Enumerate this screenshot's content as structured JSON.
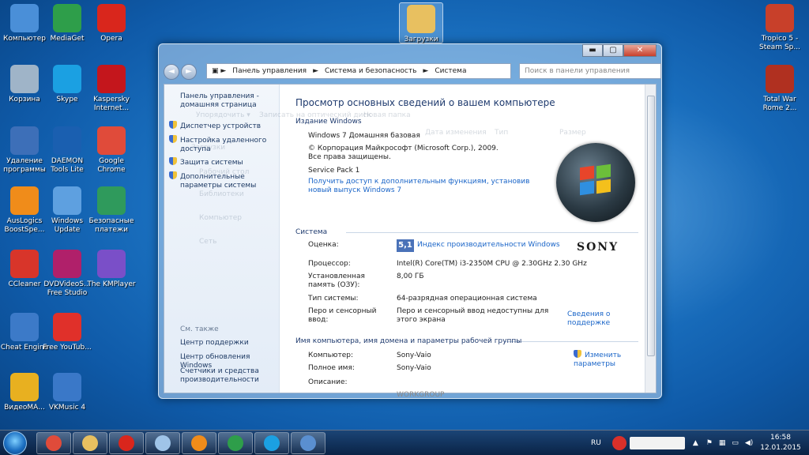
{
  "desktop": {
    "icons": [
      {
        "label": "Компьютер",
        "icon": "computer-icon",
        "color": "#4a8fd8"
      },
      {
        "label": "MediaGet",
        "icon": "mediaget-icon",
        "color": "#2e9e4a"
      },
      {
        "label": "Opera",
        "icon": "opera-icon",
        "color": "#d9261c"
      },
      {
        "label": "Корзина",
        "icon": "recycle-bin-icon",
        "color": "#9fb4c8"
      },
      {
        "label": "Skype",
        "icon": "skype-icon",
        "color": "#1ba0e2"
      },
      {
        "label": "Kaspersky Internet...",
        "icon": "kaspersky-icon",
        "color": "#c4161c"
      },
      {
        "label": "Удаление программы",
        "icon": "uninstall-icon",
        "color": "#3d6fb8"
      },
      {
        "label": "DAEMON Tools Lite",
        "icon": "daemon-tools-icon",
        "color": "#1a5fb0"
      },
      {
        "label": "Google Chrome",
        "icon": "chrome-icon",
        "color": "#e04b3a"
      },
      {
        "label": "AusLogics BoostSpe...",
        "icon": "auslogics-icon",
        "color": "#f08c1a"
      },
      {
        "label": "Windows Update",
        "icon": "windows-update-icon",
        "color": "#5ea0e0"
      },
      {
        "label": "Безопасные платежи",
        "icon": "safe-money-icon",
        "color": "#2f9a5c"
      },
      {
        "label": "CCleaner",
        "icon": "ccleaner-icon",
        "color": "#d8352a"
      },
      {
        "label": "DVDVideoS... Free Studio",
        "icon": "dvdvideosoft-icon",
        "color": "#b0206a"
      },
      {
        "label": "The KMPlayer",
        "icon": "kmplayer-icon",
        "color": "#7a4fc8"
      },
      {
        "label": "Cheat Engine",
        "icon": "cheat-engine-icon",
        "color": "#3c7ac8"
      },
      {
        "label": "Free YouTub...",
        "icon": "free-youtube-icon",
        "color": "#e0302a"
      },
      {
        "label": "ВидеоМА...",
        "icon": "videomaster-icon",
        "color": "#e8b020"
      },
      {
        "label": "VKMusic 4",
        "icon": "vkmusic-icon",
        "color": "#3a78c8"
      },
      {
        "label": "Загрузки",
        "icon": "downloads-folder-icon",
        "color": "#e8c060"
      },
      {
        "label": "Tropico 5 - Steam Sp...",
        "icon": "tropico-icon",
        "color": "#c8402a"
      },
      {
        "label": "Total War Rome 2...",
        "icon": "total-war-icon",
        "color": "#b03020"
      }
    ]
  },
  "window": {
    "controls": {
      "minimize": "▬",
      "maximize": "▢",
      "close": "✕"
    },
    "nav": {
      "back": "◄",
      "forward": "►"
    },
    "breadcrumb": [
      "Панель управления",
      "Система и безопасность",
      "Система"
    ],
    "search_placeholder": "Поиск в панели управления",
    "left_pane": {
      "home": "Панель управления - домашняя страница",
      "links": [
        "Диспетчер устройств",
        "Настройка удаленного доступа",
        "Защита системы",
        "Дополнительные параметры системы"
      ],
      "see_also": "См. также",
      "see_also_links": [
        "Центр поддержки",
        "Центр обновления Windows",
        "Счетчики и средства производительности"
      ]
    },
    "ghost": {
      "toolbar": [
        "Упорядочить ▾",
        "Записать на оптический диск",
        "Новая папка"
      ],
      "columns": [
        "Дата изменения",
        "Тип",
        "Размер"
      ],
      "tree": [
        "Загрузки",
        "Рабочий стол",
        "Библиотеки",
        "Компьютер",
        "Сеть"
      ]
    },
    "main": {
      "title": "Просмотр основных сведений о вашем компьютере",
      "edition_head": "Издание Windows",
      "edition": "Windows 7 Домашняя базовая",
      "copyright": "© Корпорация Майкрософт (Microsoft Corp.), 2009. Все права защищены.",
      "service_pack": "Service Pack 1",
      "upgrade_link": "Получить доступ к дополнительным функциям, установив новый выпуск Windows 7",
      "system_head": "Система",
      "rating_label": "Оценка:",
      "rating_value": "5,1",
      "rating_link": "Индекс производительности Windows",
      "cpu_label": "Процессор:",
      "cpu_value": "Intel(R) Core(TM) i3-2350M CPU @ 2.30GHz  2.30 GHz",
      "ram_label": "Установленная память (ОЗУ):",
      "ram_value": "8,00 ГБ",
      "type_label": "Тип системы:",
      "type_value": "64-разрядная операционная система",
      "pen_label": "Перо и сенсорный ввод:",
      "pen_value": "Перо и сенсорный ввод недоступны для этого экрана",
      "support_link": "Сведения о поддержке",
      "name_head": "Имя компьютера, имя домена и параметры рабочей группы",
      "computer_label": "Компьютер:",
      "computer_value": "Sony-Vaio",
      "fullname_label": "Полное имя:",
      "fullname_value": "Sony-Vaio",
      "desc_label": "Описание:",
      "workgroup_value": "WORKGROUP",
      "change_link": "Изменить параметры",
      "oem": "SONY"
    }
  },
  "taskbar": {
    "language": "RU",
    "time": "16:58",
    "date": "12.01.2015",
    "pinned": [
      "chrome-icon",
      "explorer-icon",
      "opera-taskbar-icon",
      "window-icon",
      "media-player-icon",
      "daemon-taskbar-icon",
      "skype-taskbar-icon",
      "control-panel-icon"
    ]
  }
}
